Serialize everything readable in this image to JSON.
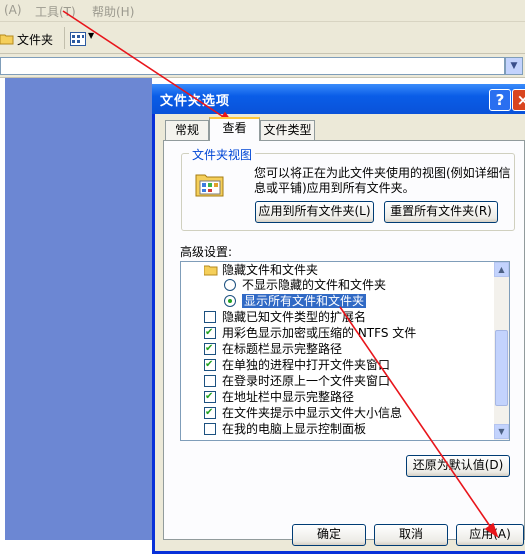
{
  "menubar": {
    "items": [
      {
        "label": "(A)"
      },
      {
        "label": "工具(T)"
      },
      {
        "label": "帮助(H)"
      }
    ]
  },
  "toolbar": {
    "folders_label": "文件夹",
    "views_icon": "views-icon"
  },
  "dialog": {
    "title": "文件夹选项",
    "help_btn": "?",
    "close_btn": "×",
    "tabs": [
      {
        "label": "常规"
      },
      {
        "label": "查看"
      },
      {
        "label": "文件类型"
      }
    ],
    "folder_views": {
      "group_label": "文件夹视图",
      "description": "您可以将正在为此文件夹使用的视图(例如详细信息或平铺)应用到所有文件夹。",
      "apply_all_label": "应用到所有文件夹(L)",
      "reset_all_label": "重置所有文件夹(R)"
    },
    "advanced": {
      "label": "高级设置:",
      "items": [
        {
          "type": "folder",
          "label": "隐藏文件和文件夹"
        },
        {
          "type": "radio",
          "checked": false,
          "label": "不显示隐藏的文件和文件夹"
        },
        {
          "type": "radio",
          "checked": true,
          "label": "显示所有文件和文件夹"
        },
        {
          "type": "checkbox",
          "checked": false,
          "label": "隐藏已知文件类型的扩展名"
        },
        {
          "type": "checkbox",
          "checked": true,
          "label": "用彩色显示加密或压缩的 NTFS 文件"
        },
        {
          "type": "checkbox",
          "checked": true,
          "label": "在标题栏显示完整路径"
        },
        {
          "type": "checkbox",
          "checked": true,
          "label": "在单独的进程中打开文件夹窗口"
        },
        {
          "type": "checkbox",
          "checked": false,
          "label": "在登录时还原上一个文件夹窗口"
        },
        {
          "type": "checkbox",
          "checked": true,
          "label": "在地址栏中显示完整路径"
        },
        {
          "type": "checkbox",
          "checked": true,
          "label": "在文件夹提示中显示文件大小信息"
        },
        {
          "type": "checkbox",
          "checked": false,
          "label": "在我的电脑上显示控制面板"
        }
      ]
    },
    "restore_defaults_label": "还原为默认值(D)",
    "ok_label": "确定",
    "cancel_label": "取消",
    "apply_label": "应用(A)"
  },
  "colors": {
    "annotation_arrow": "#e8151b",
    "titlebar": "#0a5de7"
  }
}
